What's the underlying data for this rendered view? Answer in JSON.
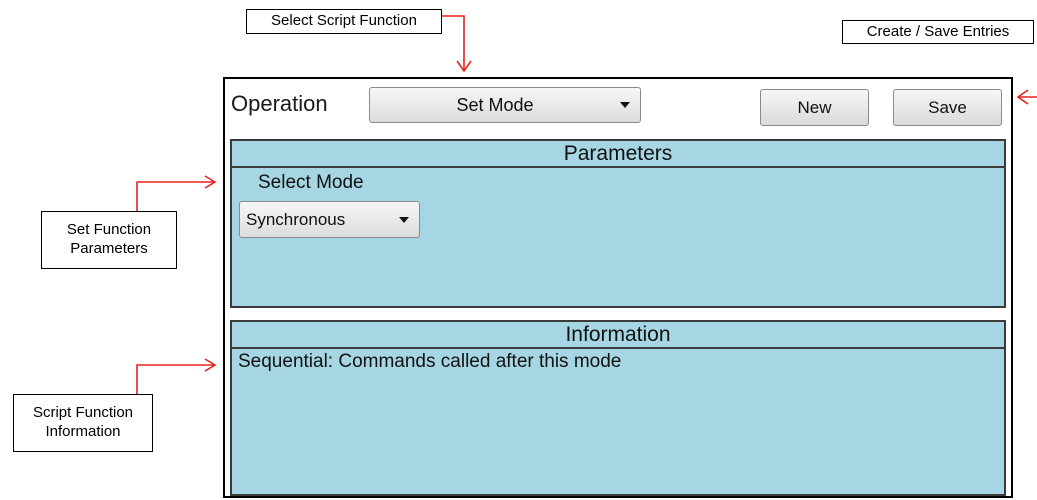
{
  "callouts": {
    "select_script_function": "Select Script Function",
    "create_save_entries": "Create / Save Entries",
    "set_function_parameters_line1": "Set Function",
    "set_function_parameters_line2": "Parameters",
    "script_function_information_line1": "Script Function",
    "script_function_information_line2": "Information"
  },
  "toolbar": {
    "operation_label": "Operation",
    "operation_value": "Set Mode",
    "new_label": "New",
    "save_label": "Save"
  },
  "parameters": {
    "header": "Parameters",
    "select_mode_label": "Select Mode",
    "select_mode_value": "Synchronous"
  },
  "information": {
    "header": "Information",
    "text": "Sequential: Commands called after this mode"
  },
  "colors": {
    "section_bg": "#a6d6e3",
    "arrow": "#e8231e"
  },
  "icons": [
    "chevron-down-icon",
    "arrow-icon"
  ]
}
